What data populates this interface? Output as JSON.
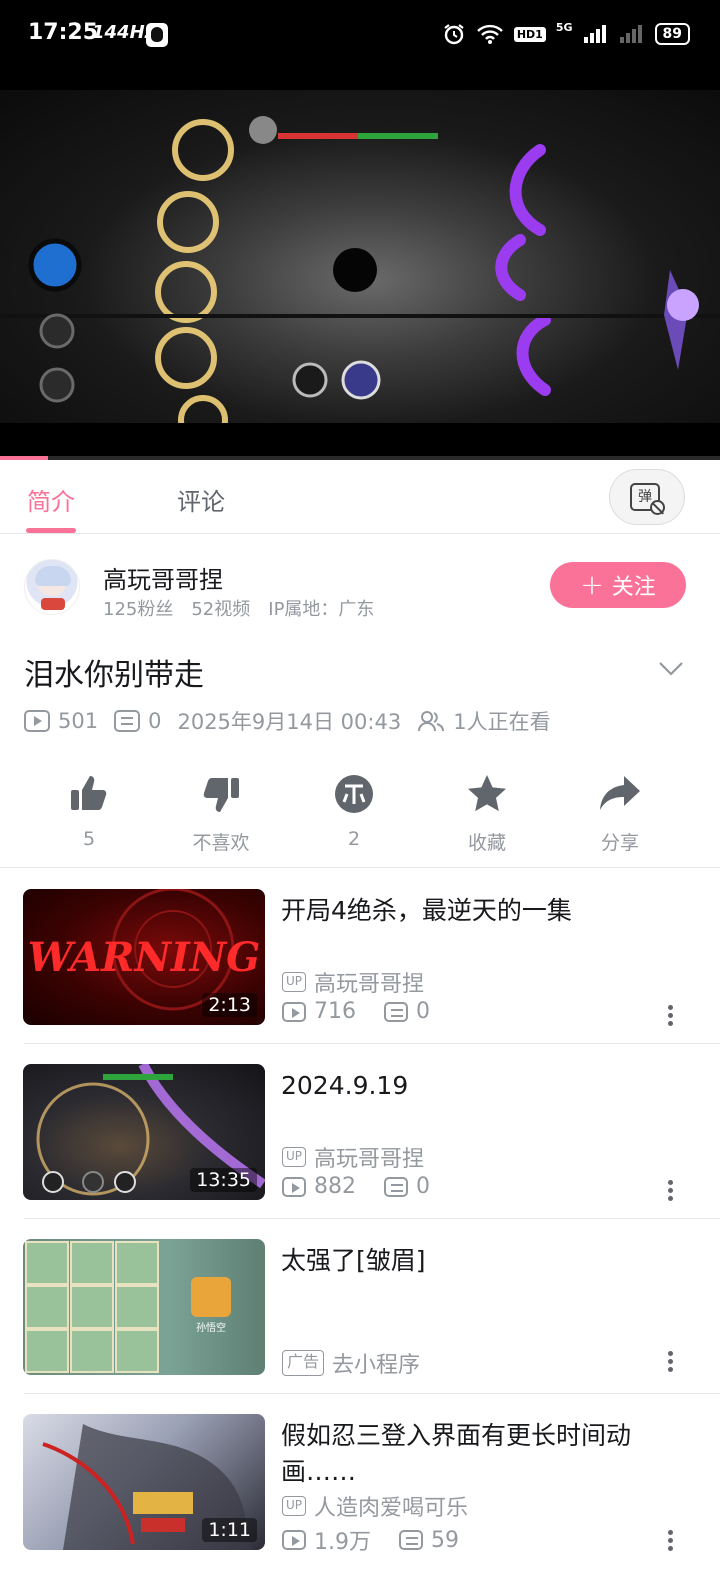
{
  "status_bar": {
    "time": "17:25",
    "refresh": "144Hz",
    "battery": "89",
    "hd": "HD1",
    "net": "5G"
  },
  "video": {
    "progress_fraction": 0.066
  },
  "tabs": {
    "intro": "简介",
    "comments": "评论",
    "danmaku_icon": "弹"
  },
  "uploader": {
    "name": "高玩哥哥捏",
    "fans": "125粉丝",
    "videos": "52视频",
    "ip": "IP属地：广东",
    "follow_label": "关注"
  },
  "video_info": {
    "title": "泪水你别带走",
    "plays": "501",
    "danmaku": "0",
    "date": "2025年9月14日 00:43",
    "watching": "1人正在看"
  },
  "actions": [
    {
      "icon": "thumbs-up-icon",
      "label": "5"
    },
    {
      "icon": "thumbs-down-icon",
      "label": "不喜欢"
    },
    {
      "icon": "coin-icon",
      "label": "2"
    },
    {
      "icon": "star-icon",
      "label": "收藏"
    },
    {
      "icon": "share-icon",
      "label": "分享"
    }
  ],
  "related": [
    {
      "title": "开局4绝杀，最逆天的一集",
      "up": "高玩哥哥捏",
      "up_tag": "UP",
      "plays": "716",
      "danmaku": "0",
      "duration": "2:13",
      "thumb_text": "WARNING"
    },
    {
      "title": "2024.9.19",
      "up": "高玩哥哥捏",
      "up_tag": "UP",
      "plays": "882",
      "danmaku": "0",
      "duration": "13:35"
    },
    {
      "title": "太强了[皱眉]",
      "ad_tag": "广告",
      "ad_action": "去小程序",
      "thumb_text": "孙悟空"
    },
    {
      "title": "假如忍三登入界面有更长时间动画……",
      "up": "人造肉爱喝可乐",
      "up_tag": "UP",
      "plays": "1.9万",
      "danmaku": "59",
      "duration": "1:11"
    }
  ]
}
